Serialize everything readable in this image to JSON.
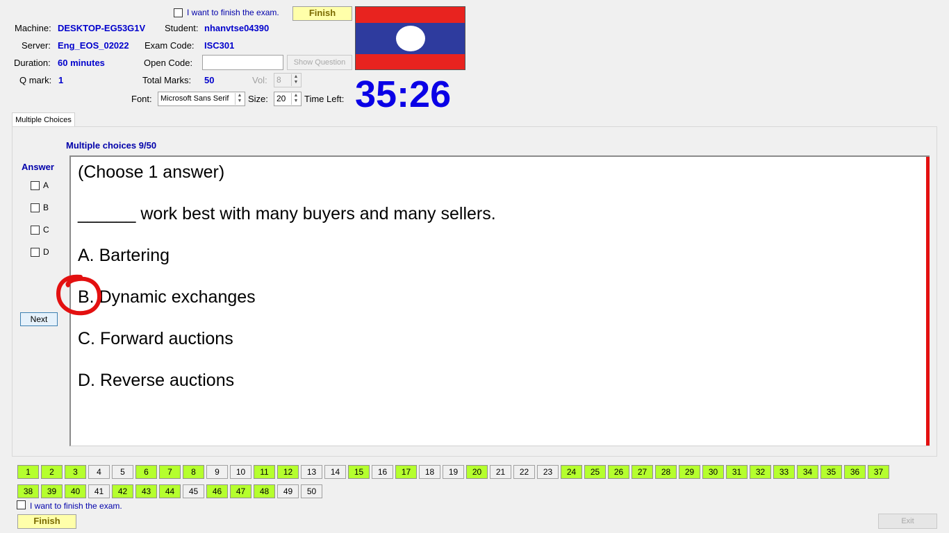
{
  "header": {
    "finish_checkbox_label": "I want to finish the exam.",
    "finish_button": "Finish",
    "machine_label": "Machine:",
    "machine_value": "DESKTOP-EG53G1V",
    "student_label": "Student:",
    "student_value": "nhanvtse04390",
    "server_label": "Server:",
    "server_value": "Eng_EOS_02022",
    "exam_code_label": "Exam Code:",
    "exam_code_value": "ISC301",
    "duration_label": "Duration:",
    "duration_value": "60 minutes",
    "open_code_label": "Open Code:",
    "open_code_value": "",
    "show_question_button": "Show Question",
    "qmark_label": "Q mark:",
    "qmark_value": "1",
    "total_marks_label": "Total Marks:",
    "total_marks_value": "50",
    "vol_label": "Vol:",
    "vol_value": "8",
    "font_label": "Font:",
    "font_value": "Microsoft Sans Serif",
    "size_label": "Size:",
    "size_value": "20",
    "time_left_label": "Time Left:",
    "time_left_value": "35:26",
    "flag_colors": {
      "red": "#e8231f",
      "blue": "#2e3b9e",
      "white": "#ffffff"
    }
  },
  "tab": {
    "label": "Multiple Choices"
  },
  "question": {
    "counter": "Multiple choices 9/50",
    "answer_heading": "Answer",
    "answer_options": [
      "A",
      "B",
      "C",
      "D"
    ],
    "next_button": "Next",
    "lines": [
      "(Choose 1 answer)",
      "______ work best with many buyers and many sellers.",
      "A.  Bartering",
      "B.  Dynamic exchanges",
      "C.  Forward auctions",
      "D.  Reverse auctions"
    ]
  },
  "navigator": {
    "numbers": [
      "1",
      "2",
      "3",
      "4",
      "5",
      "6",
      "7",
      "8",
      "9",
      "10",
      "11",
      "12",
      "13",
      "14",
      "15",
      "16",
      "17",
      "18",
      "19",
      "20",
      "21",
      "22",
      "23",
      "24",
      "25",
      "26",
      "27",
      "28",
      "29",
      "30",
      "31",
      "32",
      "33",
      "34",
      "35",
      "36",
      "37",
      "38",
      "39",
      "40",
      "41",
      "42",
      "43",
      "44",
      "45",
      "46",
      "47",
      "48",
      "49",
      "50"
    ],
    "answered": [
      1,
      2,
      3,
      6,
      7,
      8,
      11,
      12,
      15,
      17,
      20,
      24,
      25,
      26,
      27,
      28,
      29,
      30,
      31,
      32,
      33,
      34,
      35,
      36,
      37,
      38,
      39,
      40,
      42,
      43,
      44,
      46,
      47,
      48
    ],
    "answered_color": "#b5ff2e"
  },
  "footer": {
    "finish_checkbox_label": "I want to finish the exam.",
    "finish_button": "Finish",
    "exit_button": "Exit"
  }
}
